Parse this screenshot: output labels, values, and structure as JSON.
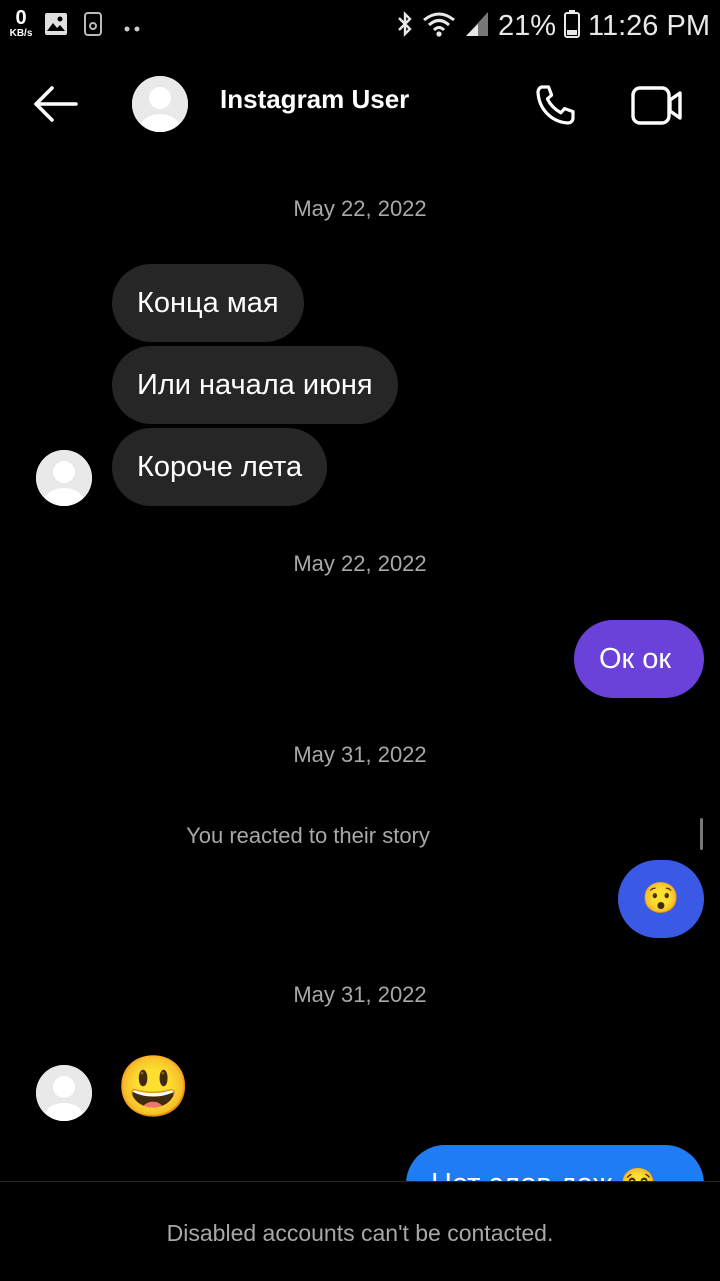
{
  "status_bar": {
    "net_speed_value": "0",
    "net_speed_unit": "KB/s",
    "battery": "21%",
    "time": "11:26 PM",
    "icons": [
      "image-icon",
      "phone-sim-icon",
      "dots-icon",
      "bluetooth-icon",
      "wifi-icon",
      "signal-icon",
      "battery-icon"
    ]
  },
  "header": {
    "title": "Instagram User",
    "icons": [
      "back-arrow-icon",
      "avatar-icon",
      "phone-icon",
      "video-icon"
    ]
  },
  "messages": {
    "date_1": "May 22, 2022",
    "in_1": "Конца мая",
    "in_2": "Или начала июня",
    "in_3": "Короче лета",
    "date_2": "May 22, 2022",
    "out_1": "Ок ок",
    "date_3": "May 31, 2022",
    "reaction_note": "You reacted to their story",
    "reaction_emoji": "😯",
    "date_4": "May 31, 2022",
    "in_emoji": "😃",
    "out_partial": "Нет слов даж 😂"
  },
  "footer": {
    "notice": "Disabled accounts can't be contacted."
  },
  "colors": {
    "background": "#000000",
    "incoming_bubble": "#262626",
    "outgoing_purple": "#6a42d9",
    "outgoing_blue": "#3a5ae6",
    "outgoing_last": "#1f7cf2",
    "muted_text": "#a8a8a8"
  }
}
